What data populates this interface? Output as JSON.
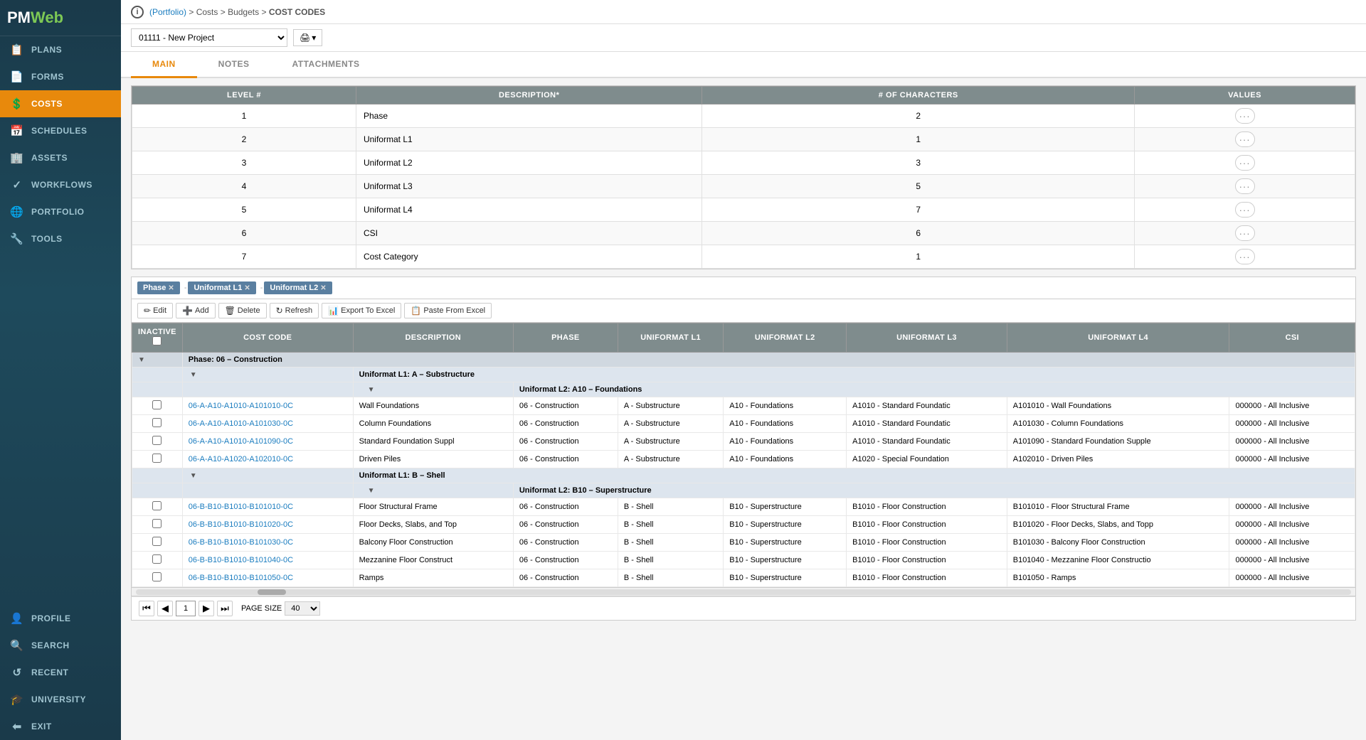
{
  "sidebar": {
    "logo": "PMWeb",
    "items": [
      {
        "id": "plans",
        "label": "PLANS",
        "icon": "📋"
      },
      {
        "id": "forms",
        "label": "FORMS",
        "icon": "📄"
      },
      {
        "id": "costs",
        "label": "COSTS",
        "icon": "💲",
        "active": true
      },
      {
        "id": "schedules",
        "label": "SCHEDULES",
        "icon": "📅"
      },
      {
        "id": "assets",
        "label": "ASSETS",
        "icon": "🏢"
      },
      {
        "id": "workflows",
        "label": "WORKFLOWS",
        "icon": "✓"
      },
      {
        "id": "portfolio",
        "label": "PORTFOLIO",
        "icon": "🌐"
      },
      {
        "id": "tools",
        "label": "TOOLS",
        "icon": "🔧"
      },
      {
        "id": "profile",
        "label": "PROFILE",
        "icon": "👤"
      },
      {
        "id": "search",
        "label": "SEARCH",
        "icon": "🔍"
      },
      {
        "id": "recent",
        "label": "RECENT",
        "icon": "↺"
      },
      {
        "id": "university",
        "label": "UNIVERSITY",
        "icon": "🎓"
      },
      {
        "id": "exit",
        "label": "EXIT",
        "icon": "⬅"
      }
    ]
  },
  "breadcrumb": {
    "portfolio": "(Portfolio)",
    "sep1": " > ",
    "costs": "Costs",
    "sep2": " > ",
    "budgets": "Budgets",
    "sep3": " > ",
    "current": "COST CODES"
  },
  "project_selector": {
    "value": "01111 - New Project",
    "options": [
      "01111 - New Project"
    ]
  },
  "tabs": [
    {
      "id": "main",
      "label": "MAIN",
      "active": true
    },
    {
      "id": "notes",
      "label": "NOTES"
    },
    {
      "id": "attachments",
      "label": "ATTACHMENTS"
    }
  ],
  "level_table": {
    "columns": [
      "LEVEL #",
      "DESCRIPTION*",
      "# OF CHARACTERS",
      "VALUES"
    ],
    "rows": [
      {
        "level": "1",
        "description": "Phase",
        "characters": "2"
      },
      {
        "level": "2",
        "description": "Uniformat L1",
        "characters": "1"
      },
      {
        "level": "3",
        "description": "Uniformat L2",
        "characters": "3"
      },
      {
        "level": "4",
        "description": "Uniformat L3",
        "characters": "5"
      },
      {
        "level": "5",
        "description": "Uniformat L4",
        "characters": "7"
      },
      {
        "level": "6",
        "description": "CSI",
        "characters": "6"
      },
      {
        "level": "7",
        "description": "Cost Category",
        "characters": "1"
      }
    ]
  },
  "filters": [
    {
      "label": "Phase",
      "closeable": true
    },
    {
      "sep": "-"
    },
    {
      "label": "Uniformat L1",
      "closeable": true
    },
    {
      "sep": "-"
    },
    {
      "label": "Uniformat L2",
      "closeable": true
    }
  ],
  "toolbar": {
    "edit_label": "Edit",
    "add_label": "Add",
    "delete_label": "Delete",
    "refresh_label": "Refresh",
    "export_label": "Export To Excel",
    "paste_label": "Paste From Excel"
  },
  "data_table": {
    "columns": [
      "INACTIVE",
      "COST CODE",
      "DESCRIPTION",
      "PHASE",
      "UNIFORMAT L1",
      "UNIFORMAT L2",
      "UNIFORMAT L3",
      "UNIFORMAT L4",
      "CSI"
    ],
    "groups": [
      {
        "label": "Phase: 06 – Construction",
        "subgroups": [
          {
            "label": "Uniformat L1: A – Substructure",
            "sub2groups": [
              {
                "label": "Uniformat L2: A10 – Foundations",
                "rows": [
                  {
                    "code": "06-A-A10-A1010-A101010-0C",
                    "description": "Wall Foundations",
                    "phase": "06 - Construction",
                    "uni_l1": "A - Substructure",
                    "uni_l2": "A10 - Foundations",
                    "uni_l3": "A1010 - Standard Foundatic",
                    "uni_l4": "A101010 - Wall Foundations",
                    "csi": "000000 - All Inclusive"
                  },
                  {
                    "code": "06-A-A10-A1010-A101030-0C",
                    "description": "Column Foundations",
                    "phase": "06 - Construction",
                    "uni_l1": "A - Substructure",
                    "uni_l2": "A10 - Foundations",
                    "uni_l3": "A1010 - Standard Foundatic",
                    "uni_l4": "A101030 - Column Foundations",
                    "csi": "000000 - All Inclusive"
                  },
                  {
                    "code": "06-A-A10-A1010-A101090-0C",
                    "description": "Standard Foundation Suppl",
                    "phase": "06 - Construction",
                    "uni_l1": "A - Substructure",
                    "uni_l2": "A10 - Foundations",
                    "uni_l3": "A1010 - Standard Foundatic",
                    "uni_l4": "A101090 - Standard Foundation Supple",
                    "csi": "000000 - All Inclusive"
                  },
                  {
                    "code": "06-A-A10-A1020-A102010-0C",
                    "description": "Driven Piles",
                    "phase": "06 - Construction",
                    "uni_l1": "A - Substructure",
                    "uni_l2": "A10 - Foundations",
                    "uni_l3": "A1020 - Special Foundation",
                    "uni_l4": "A102010 - Driven Piles",
                    "csi": "000000 - All Inclusive"
                  }
                ]
              }
            ]
          },
          {
            "label": "Uniformat L1: B – Shell",
            "sub2groups": [
              {
                "label": "Uniformat L2: B10 – Superstructure",
                "rows": [
                  {
                    "code": "06-B-B10-B1010-B101010-0C",
                    "description": "Floor Structural Frame",
                    "phase": "06 - Construction",
                    "uni_l1": "B - Shell",
                    "uni_l2": "B10 - Superstructure",
                    "uni_l3": "B1010 - Floor Construction",
                    "uni_l4": "B101010 - Floor Structural Frame",
                    "csi": "000000 - All Inclusive"
                  },
                  {
                    "code": "06-B-B10-B1010-B101020-0C",
                    "description": "Floor Decks, Slabs, and Top",
                    "phase": "06 - Construction",
                    "uni_l1": "B - Shell",
                    "uni_l2": "B10 - Superstructure",
                    "uni_l3": "B1010 - Floor Construction",
                    "uni_l4": "B101020 - Floor Decks, Slabs, and Topp",
                    "csi": "000000 - All Inclusive"
                  },
                  {
                    "code": "06-B-B10-B1010-B101030-0C",
                    "description": "Balcony Floor Construction",
                    "phase": "06 - Construction",
                    "uni_l1": "B - Shell",
                    "uni_l2": "B10 - Superstructure",
                    "uni_l3": "B1010 - Floor Construction",
                    "uni_l4": "B101030 - Balcony Floor Construction",
                    "csi": "000000 - All Inclusive"
                  },
                  {
                    "code": "06-B-B10-B1010-B101040-0C",
                    "description": "Mezzanine Floor Construct",
                    "phase": "06 - Construction",
                    "uni_l1": "B - Shell",
                    "uni_l2": "B10 - Superstructure",
                    "uni_l3": "B1010 - Floor Construction",
                    "uni_l4": "B101040 - Mezzanine Floor Constructio",
                    "csi": "000000 - All Inclusive"
                  },
                  {
                    "code": "06-B-B10-B1010-B101050-0C",
                    "description": "Ramps",
                    "phase": "06 - Construction",
                    "uni_l1": "B - Shell",
                    "uni_l2": "B10 - Superstructure",
                    "uni_l3": "B1010 - Floor Construction",
                    "uni_l4": "B101050 - Ramps",
                    "csi": "000000 - All Inclusive"
                  }
                ]
              }
            ]
          }
        ]
      }
    ]
  },
  "pagination": {
    "current_page": "1",
    "page_size": "40"
  }
}
